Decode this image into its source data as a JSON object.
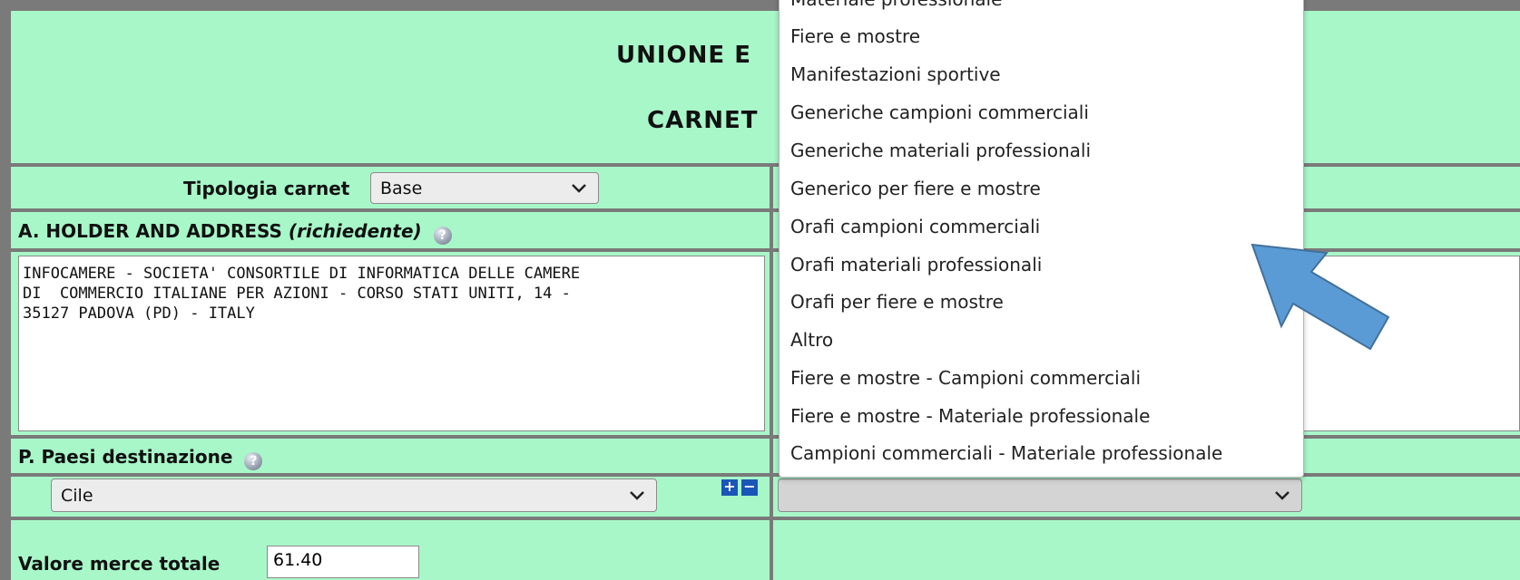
{
  "header": {
    "title_line1": "UNIONE E",
    "title_line2": "CARNET"
  },
  "tipologia": {
    "label": "Tipologia carnet",
    "selected": "Base"
  },
  "holder": {
    "label_prefix": "A. HOLDER AND ADDRESS ",
    "label_italic": "(richiedente)",
    "address": "INFOCAMERE - SOCIETA' CONSORTILE DI INFORMATICA DELLE CAMERE\nDI  COMMERCIO ITALIANE PER AZIONI - CORSO STATI UNITI, 14 -\n35127 PADOVA (PD) - ITALY"
  },
  "paesi": {
    "label": "P. Paesi destinazione",
    "selected": "Cile",
    "add_button": "+",
    "remove_button": "−"
  },
  "valore": {
    "label": "Valore merce totale",
    "value": "61.40"
  },
  "categoria_select": {
    "selected": "",
    "options": [
      "Materiale professionale",
      "Fiere e mostre",
      "Manifestazioni sportive",
      "Generiche campioni commerciali",
      "Generiche materiali professionali",
      "Generico per fiere e mostre",
      "Orafi campioni commerciali",
      "Orafi materiali professionali",
      "Orafi per fiere e mostre",
      "Altro",
      "Fiere e mostre - Campioni commerciali",
      "Fiere e mostre - Materiale professionale",
      "Campioni commerciali - Materiale professionale"
    ]
  },
  "colors": {
    "panel_bg": "#a8f7c9",
    "border": "#7a7a7a",
    "arrow": "#5b9bd5",
    "button_blue": "#1a56b8"
  }
}
